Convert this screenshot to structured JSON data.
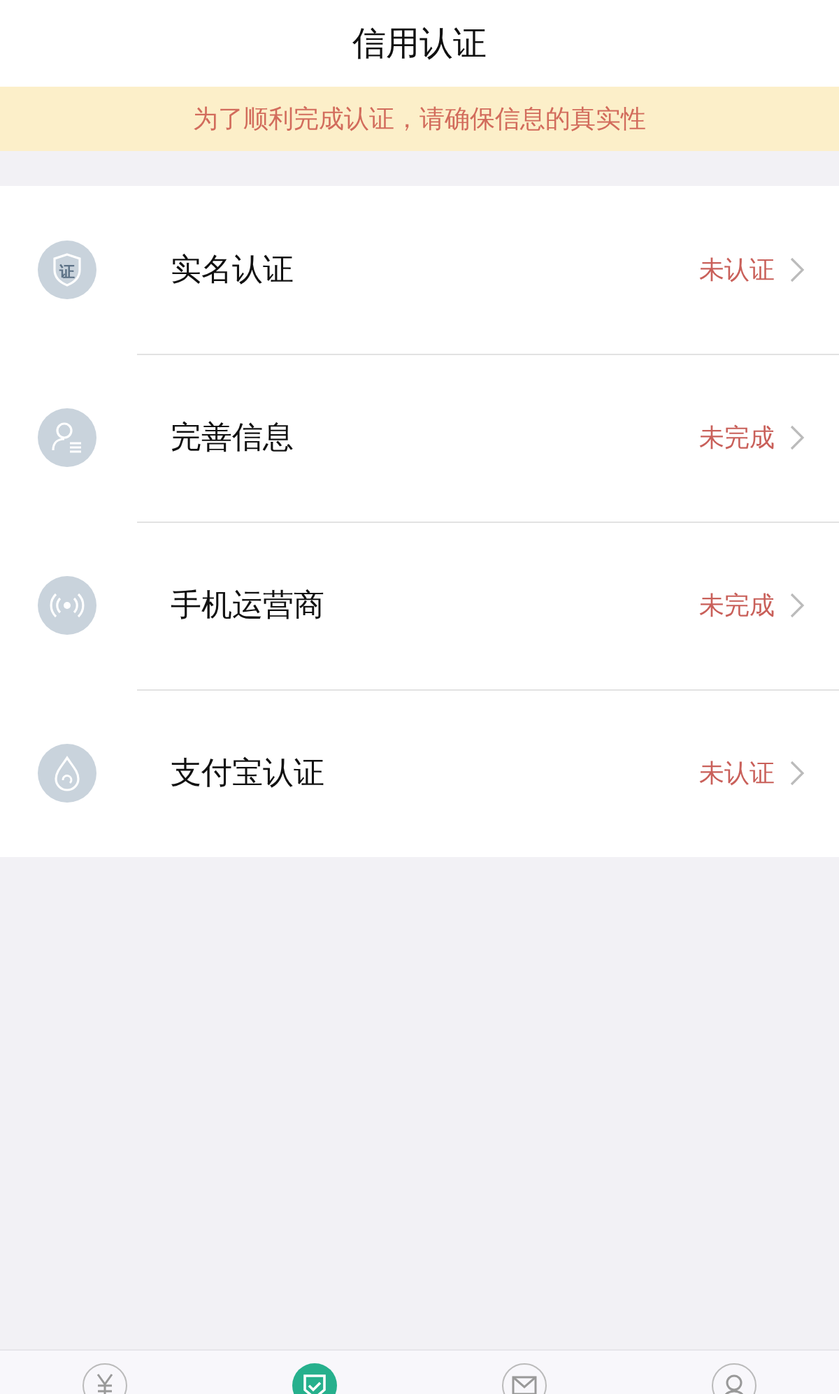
{
  "header": {
    "title": "信用认证"
  },
  "notice": "为了顺利完成认证，请确保信息的真实性",
  "items": [
    {
      "kind": "id",
      "badge": "证",
      "label": "实名认证",
      "status": "未认证"
    },
    {
      "kind": "profile",
      "label": "完善信息",
      "status": "未完成"
    },
    {
      "kind": "carrier",
      "label": "手机运营商",
      "status": "未完成"
    },
    {
      "kind": "alipay",
      "label": "支付宝认证",
      "status": "未认证"
    }
  ],
  "tabbar": [
    {
      "kind": "yen",
      "selected": false
    },
    {
      "kind": "credit",
      "selected": true
    },
    {
      "kind": "mail",
      "selected": false
    },
    {
      "kind": "profile",
      "selected": false
    }
  ]
}
